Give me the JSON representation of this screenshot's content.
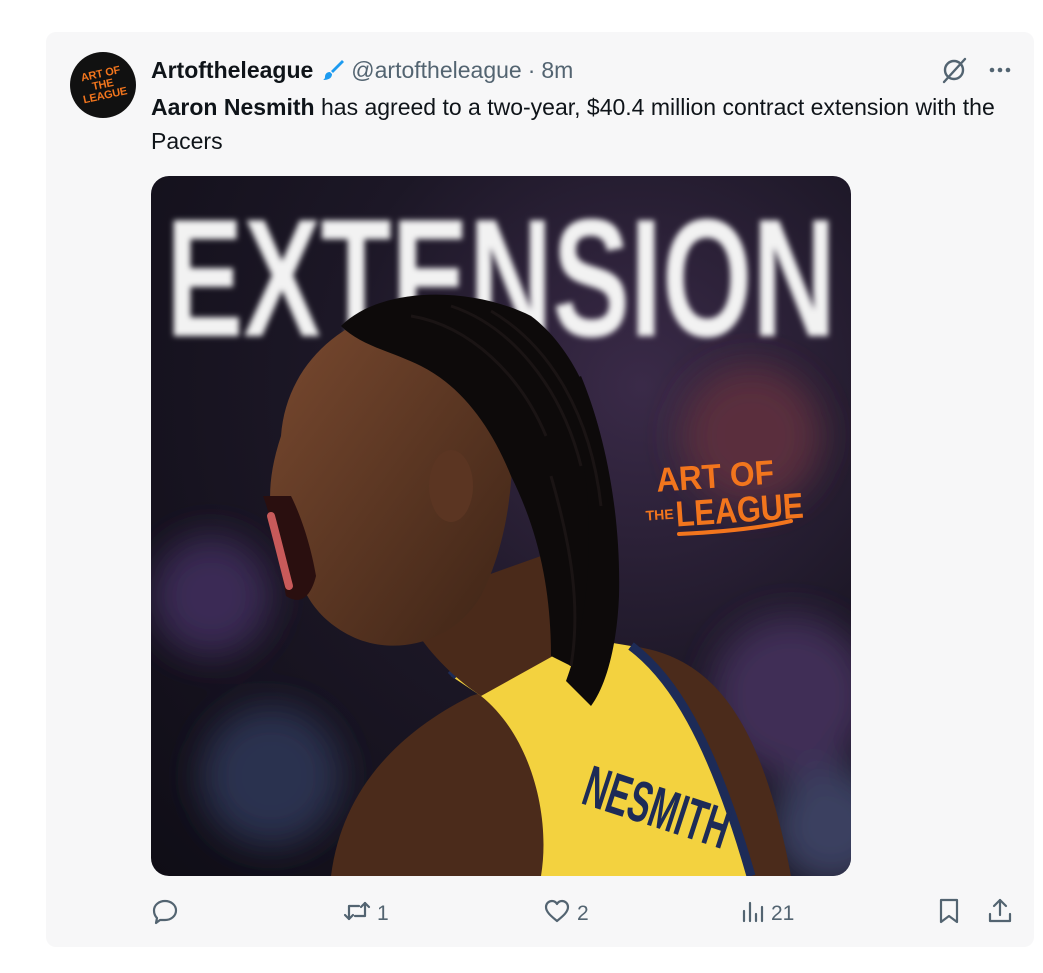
{
  "tweet": {
    "display_name": "Artoftheleague",
    "handle": "@artoftheleague",
    "separator": "·",
    "time": "8m",
    "text_bold": "Aaron Nesmith",
    "text_rest": " has agreed to a two-year, $40.4 million contract extension with the Pacers",
    "avatar_text_line1": "ART OF",
    "avatar_text_line2": "THE LEAGUE"
  },
  "media": {
    "headline": "EXTENSION",
    "logo_line1": "ART OF",
    "logo_the": "THE",
    "logo_line2": "LEAGUE",
    "jersey_name": "NESMITH",
    "colors": {
      "jersey": "#f3d23f",
      "jersey_trim": "#1d2b57",
      "logo": "#f2751d",
      "skin": "#5a3623"
    }
  },
  "actions": {
    "reply_icon": "reply-icon",
    "retweet_count": "1",
    "like_count": "2",
    "views_count": "21"
  },
  "colors": {
    "accent": "#1d9bf0",
    "muted": "#536471",
    "card_bg": "#f7f7f8"
  }
}
